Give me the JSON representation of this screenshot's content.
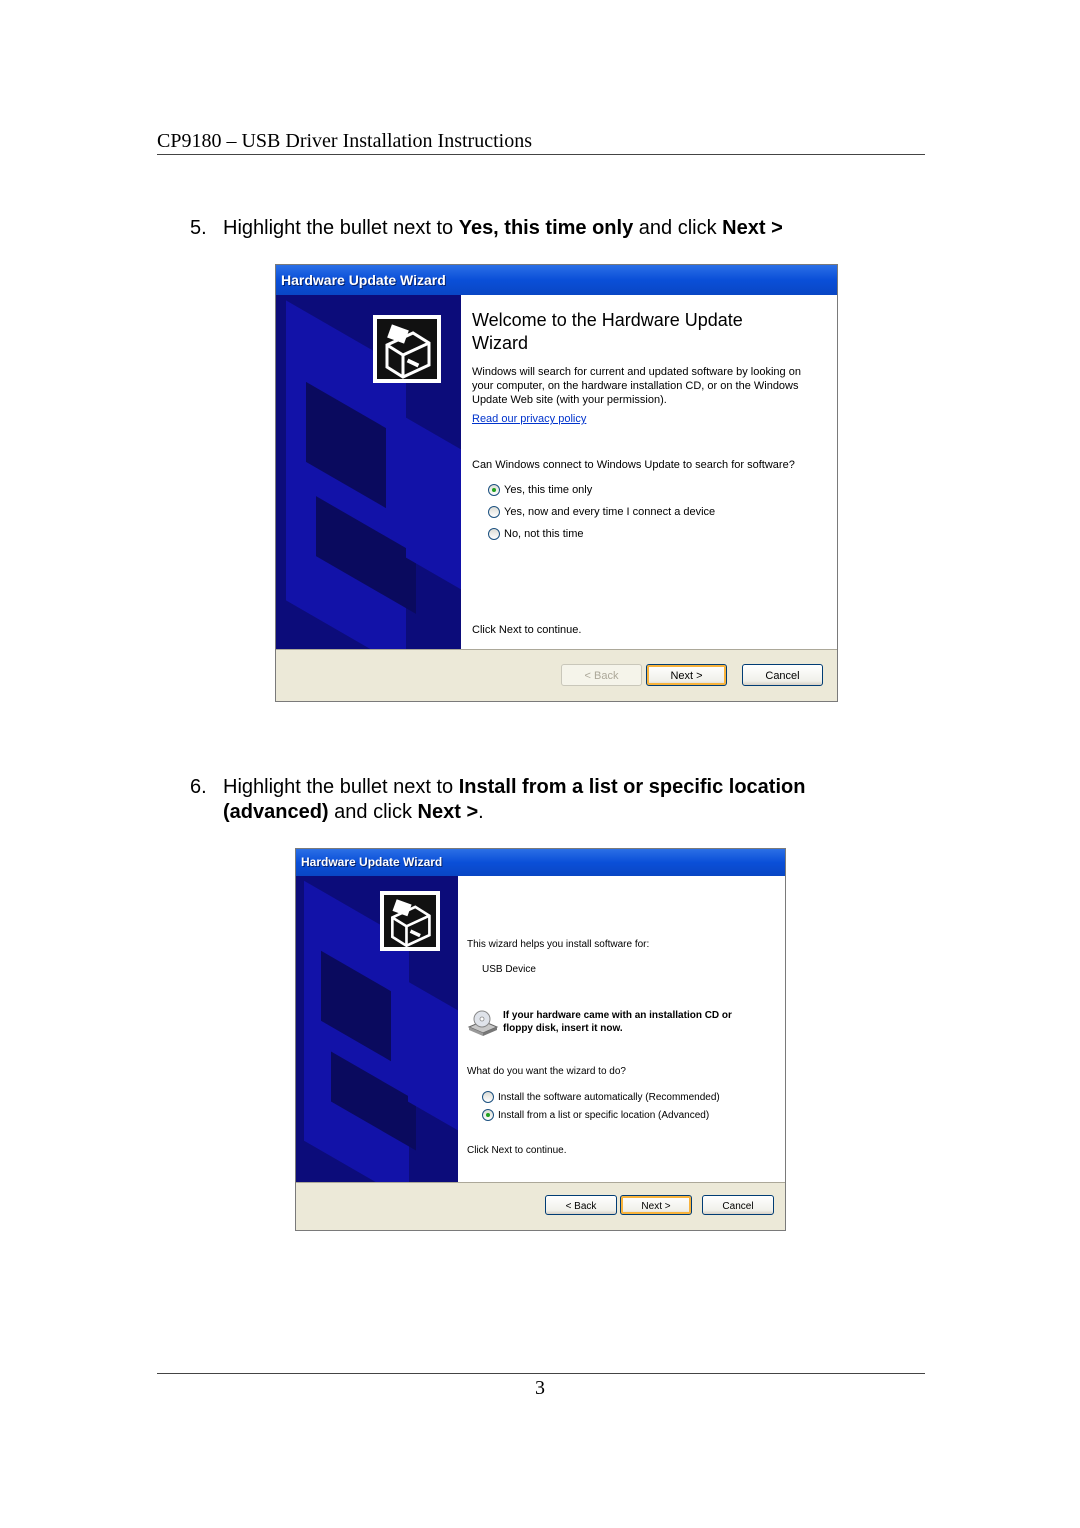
{
  "document": {
    "header": "CP9180 – USB Driver Installation Instructions",
    "page_number": "3"
  },
  "steps": [
    {
      "number": "5.",
      "segments": [
        {
          "text": "Highlight the bullet next to ",
          "bold": false
        },
        {
          "text": "Yes, this time only",
          "bold": true
        },
        {
          "text": " and click ",
          "bold": false
        },
        {
          "text": "Next >",
          "bold": true
        }
      ]
    },
    {
      "number": "6.",
      "line1": [
        {
          "text": "Highlight the bullet next to ",
          "bold": false
        },
        {
          "text": "Install from a list or specific location",
          "bold": true
        }
      ],
      "line2": [
        {
          "text": "(advanced)",
          "bold": true
        },
        {
          "text": " and click ",
          "bold": false
        },
        {
          "text": "Next >",
          "bold": true
        },
        {
          "text": ".",
          "bold": false
        }
      ]
    }
  ],
  "wizard1": {
    "title": "Hardware Update Wizard",
    "heading": "Welcome to the Hardware Update Wizard",
    "description": "Windows will search for current and updated software by looking on your computer, on the hardware installation CD, or on the Windows Update Web site (with your permission).",
    "privacy_link": "Read our privacy policy",
    "question": "Can Windows connect to Windows Update to search for software?",
    "options": [
      {
        "label": "Yes, this time only",
        "selected": true
      },
      {
        "label": "Yes, now and every time I connect a device",
        "selected": false
      },
      {
        "label": "No, not this time",
        "selected": false
      }
    ],
    "continue_text": "Click Next to continue.",
    "buttons": {
      "back": "< Back",
      "next": "Next >",
      "cancel": "Cancel"
    },
    "back_enabled": false
  },
  "wizard2": {
    "title": "Hardware Update Wizard",
    "intro": "This wizard helps you install software for:",
    "device_name": "USB Device",
    "cd_prompt": "If your hardware came with an installation CD or floppy disk, insert it now.",
    "question": "What do you want the wizard to do?",
    "options": [
      {
        "label": "Install the software automatically (Recommended)",
        "selected": false
      },
      {
        "label": "Install from a list or specific location (Advanced)",
        "selected": true
      }
    ],
    "continue_text": "Click Next to continue.",
    "buttons": {
      "back": "< Back",
      "next": "Next >",
      "cancel": "Cancel"
    },
    "back_enabled": true
  },
  "colors": {
    "titlebar": "#0a4fd8",
    "sidebar": "#0c0c7a",
    "link": "#0033cc",
    "radio_selected": "#21a121",
    "default_button_highlight": "#f8b33c"
  }
}
